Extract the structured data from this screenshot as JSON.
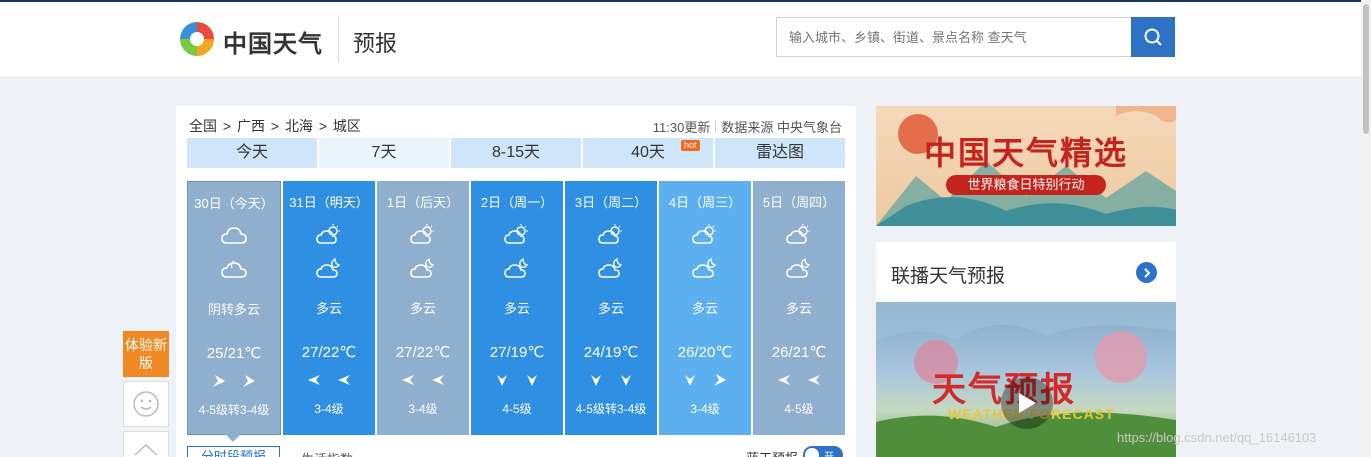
{
  "header": {
    "brand": "中国天气",
    "section": "预报",
    "search_placeholder": "输入城市、乡镇、街道、景点名称 查天气"
  },
  "breadcrumb": [
    "全国",
    "广西",
    "北海",
    "城区"
  ],
  "breadcrumb_sep": ">",
  "meta": {
    "updated": "11:30更新",
    "source": "数据来源 中央气象台"
  },
  "tabs": [
    {
      "label": "今天"
    },
    {
      "label": "7天"
    },
    {
      "label": "8-15天"
    },
    {
      "label": "40天",
      "badge": "hot"
    },
    {
      "label": "雷达图"
    }
  ],
  "days": [
    {
      "date": "30日（今天）",
      "weather": "阴转多云",
      "temp": "25/21℃",
      "wind": "4-5级转3-4级",
      "day_icon": "cloudy-icon",
      "night_icon": "cloudy-night-icon",
      "wind_dir": [
        "northeast",
        "northeast"
      ],
      "bg": "#8fafcf"
    },
    {
      "date": "31日（明天）",
      "weather": "多云",
      "temp": "27/22℃",
      "wind": "3-4级",
      "day_icon": "partly-cloudy-icon",
      "night_icon": "partly-cloudy-night-icon",
      "wind_dir": [
        "east",
        "east"
      ],
      "bg": "#2f8fe3"
    },
    {
      "date": "1日（后天）",
      "weather": "多云",
      "temp": "27/22℃",
      "wind": "3-4级",
      "day_icon": "partly-cloudy-icon",
      "night_icon": "partly-cloudy-night-icon",
      "wind_dir": [
        "east",
        "east"
      ],
      "bg": "#8fafcf"
    },
    {
      "date": "2日（周一）",
      "weather": "多云",
      "temp": "27/19℃",
      "wind": "4-5级",
      "day_icon": "partly-cloudy-icon",
      "night_icon": "partly-cloudy-night-icon",
      "wind_dir": [
        "north",
        "north"
      ],
      "bg": "#2f8fe3"
    },
    {
      "date": "3日（周二）",
      "weather": "多云",
      "temp": "24/19℃",
      "wind": "4-5级转3-4级",
      "day_icon": "partly-cloudy-icon",
      "night_icon": "partly-cloudy-night-icon",
      "wind_dir": [
        "north",
        "north"
      ],
      "bg": "#2f8fe3"
    },
    {
      "date": "4日（周三）",
      "weather": "多云",
      "temp": "26/20℃",
      "wind": "3-4级",
      "day_icon": "partly-cloudy-icon",
      "night_icon": "partly-cloudy-night-icon",
      "wind_dir": [
        "north",
        "northeast"
      ],
      "bg": "#5cb0f0"
    },
    {
      "date": "5日（周四）",
      "weather": "多云",
      "temp": "26/21℃",
      "wind": "4-5级",
      "day_icon": "partly-cloudy-icon",
      "night_icon": "partly-cloudy-night-icon",
      "wind_dir": [
        "east",
        "east"
      ],
      "bg": "#8fafcf"
    }
  ],
  "subtabs": [
    "分时段预报",
    "生活指数"
  ],
  "alarm": {
    "label": "蓝天预报",
    "toggle": "开"
  },
  "float": {
    "experience": "体验新版"
  },
  "banner": {
    "title": "中国天气精选",
    "ribbon": "世界粮食日特别行动"
  },
  "lianbo": {
    "title": "联播天气预报",
    "video_title": "天气预报",
    "video_sub": "WEATHER FORECAST"
  },
  "watermark": "https://blog.csdn.net/qq_16146103",
  "colors": {
    "accent": "#2d72c4",
    "tab_bg": "#cfe5f9",
    "orange": "#f08a24"
  }
}
